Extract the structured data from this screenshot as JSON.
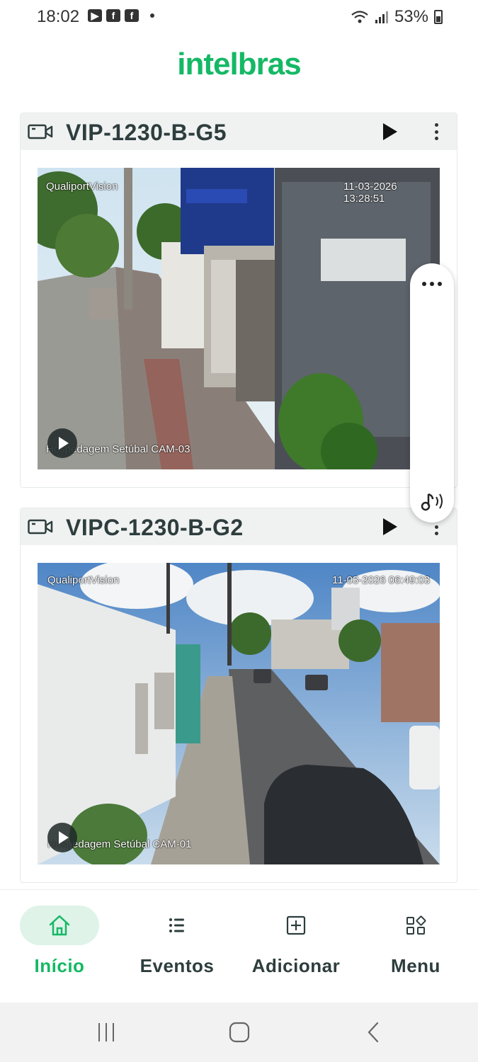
{
  "status_bar": {
    "time": "18:02",
    "left_icons": [
      "youtube-icon",
      "facebook-icon",
      "facebook-icon"
    ],
    "battery": "53%"
  },
  "brand": {
    "logo_text": "intelbras",
    "color": "#15b865"
  },
  "cameras": [
    {
      "title": "VIP-1230-B-G5",
      "overlay_brand": "QualiportVision",
      "overlay_timestamp": "11-03-2026 13:28:51",
      "overlay_name": "Hospedagem Setúbal CAM-03"
    },
    {
      "title": "VIPC-1230-B-G2",
      "overlay_brand": "QualiportVision",
      "overlay_timestamp": "11-03-2026 06:49:03",
      "overlay_name": "Hospedagem Setúbal CAM-01"
    }
  ],
  "bottom_nav": [
    {
      "label": "Início",
      "icon": "home-icon",
      "active": true
    },
    {
      "label": "Eventos",
      "icon": "list-icon",
      "active": false
    },
    {
      "label": "Adicionar",
      "icon": "add-square-icon",
      "active": false
    },
    {
      "label": "Menu",
      "icon": "grid-icon",
      "active": false
    }
  ],
  "colors": {
    "accent": "#15b865",
    "active_pill": "#dff3e8",
    "header_bg": "#f0f2f2"
  }
}
